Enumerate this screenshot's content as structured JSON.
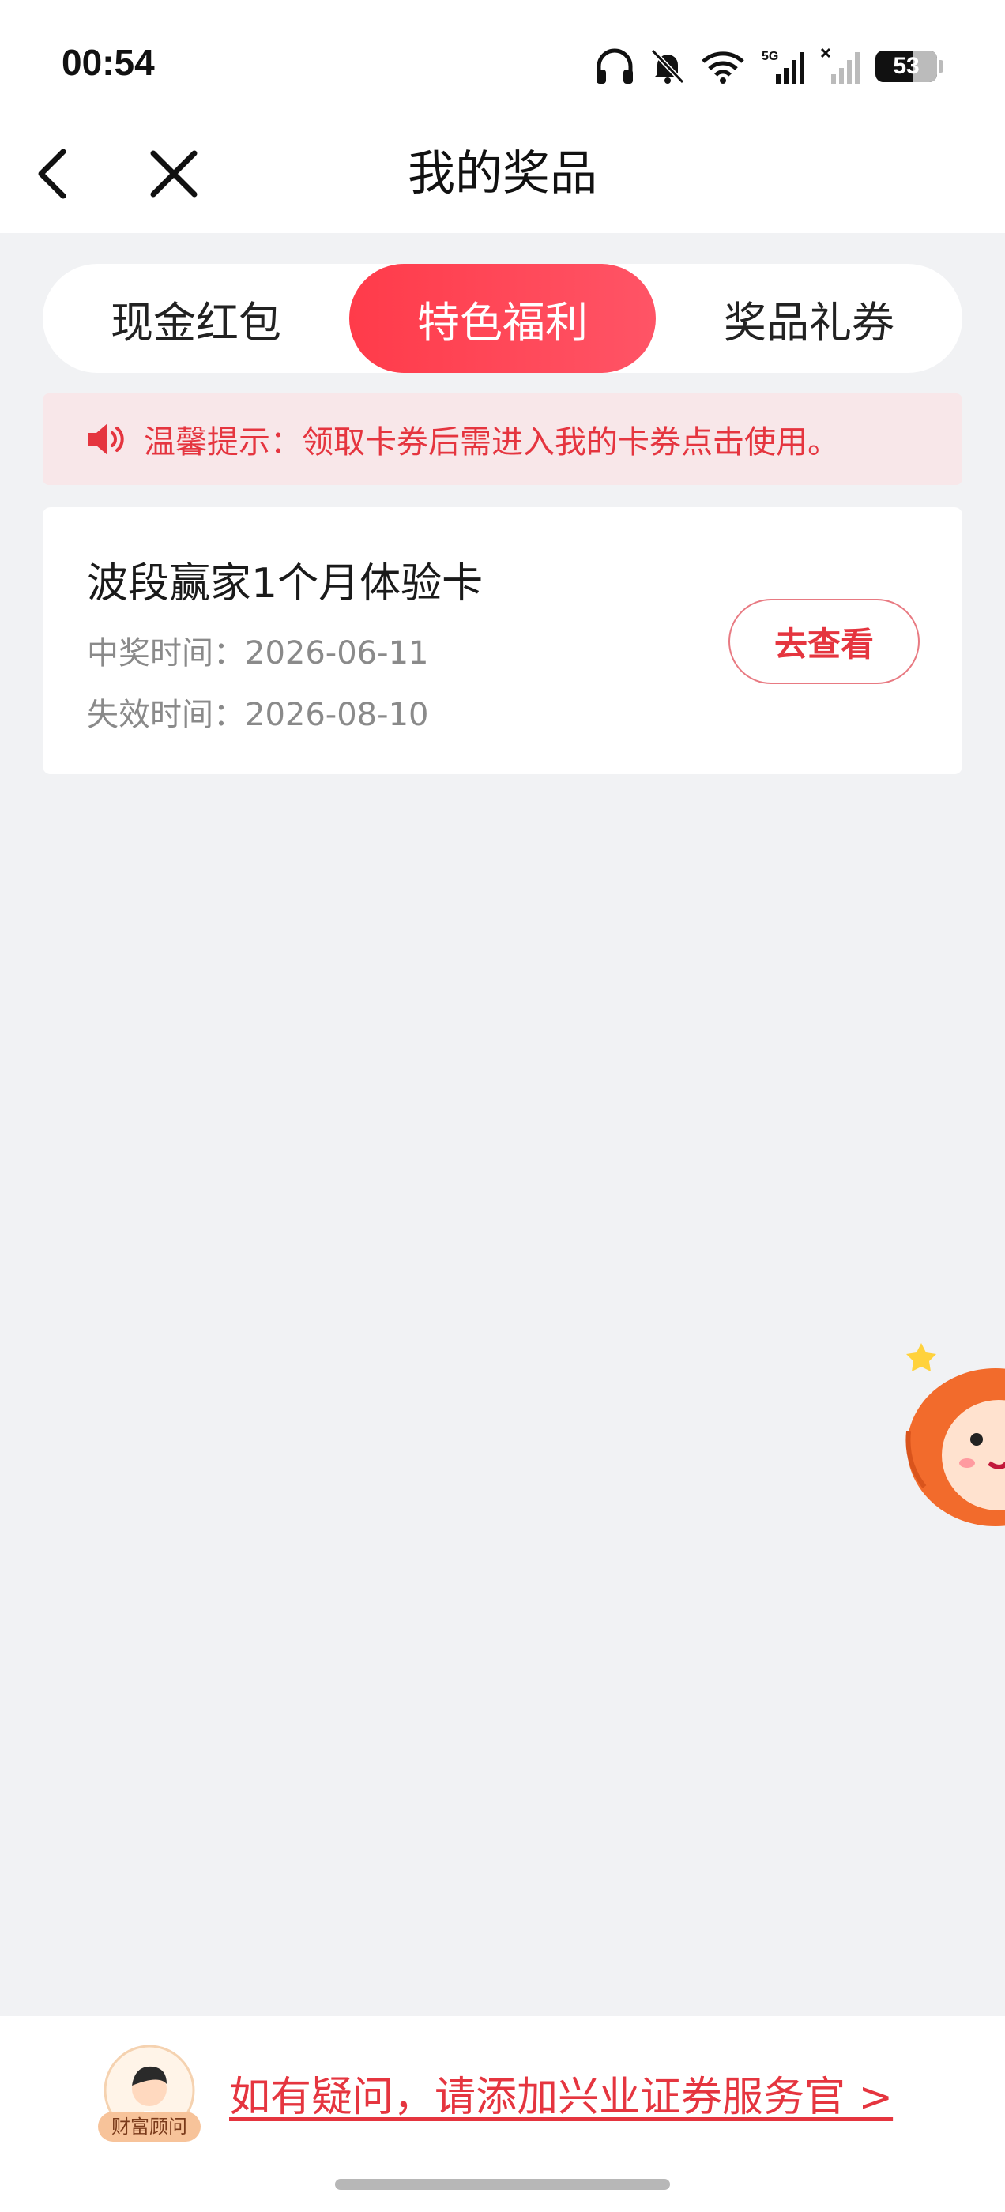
{
  "status_bar": {
    "time": "00:54",
    "battery": "53",
    "network": "5G",
    "icons": [
      "headphones-icon",
      "bell-muted-icon",
      "wifi-icon",
      "signal-5g-icon",
      "signal-no-sim-icon",
      "battery-icon"
    ]
  },
  "nav": {
    "title": "我的奖品",
    "back_icon": "chevron-left-icon",
    "close_icon": "close-icon"
  },
  "tabs": [
    {
      "label": "现金红包",
      "active": false
    },
    {
      "label": "特色福利",
      "active": true
    },
    {
      "label": "奖品礼券",
      "active": false
    }
  ],
  "notice": {
    "icon": "speaker-icon",
    "text": "温馨提示：领取卡券后需进入我的卡券点击使用。"
  },
  "prize_card": {
    "title": "波段赢家1个月体验卡",
    "win_time_label": "中奖时间：",
    "win_time": "2026-06-11",
    "expire_time_label": "失效时间：",
    "expire_time": "2026-08-10",
    "button_label": "去查看"
  },
  "footer": {
    "advisor_badge": "财富顾问",
    "link_text": "如有疑问，请添加兴业证券服务官 >"
  },
  "colors": {
    "accent": "#ff3b4a",
    "accent_text": "#e5353f",
    "notice_bg": "#f8e7e9",
    "page_bg": "#f1f2f4"
  }
}
